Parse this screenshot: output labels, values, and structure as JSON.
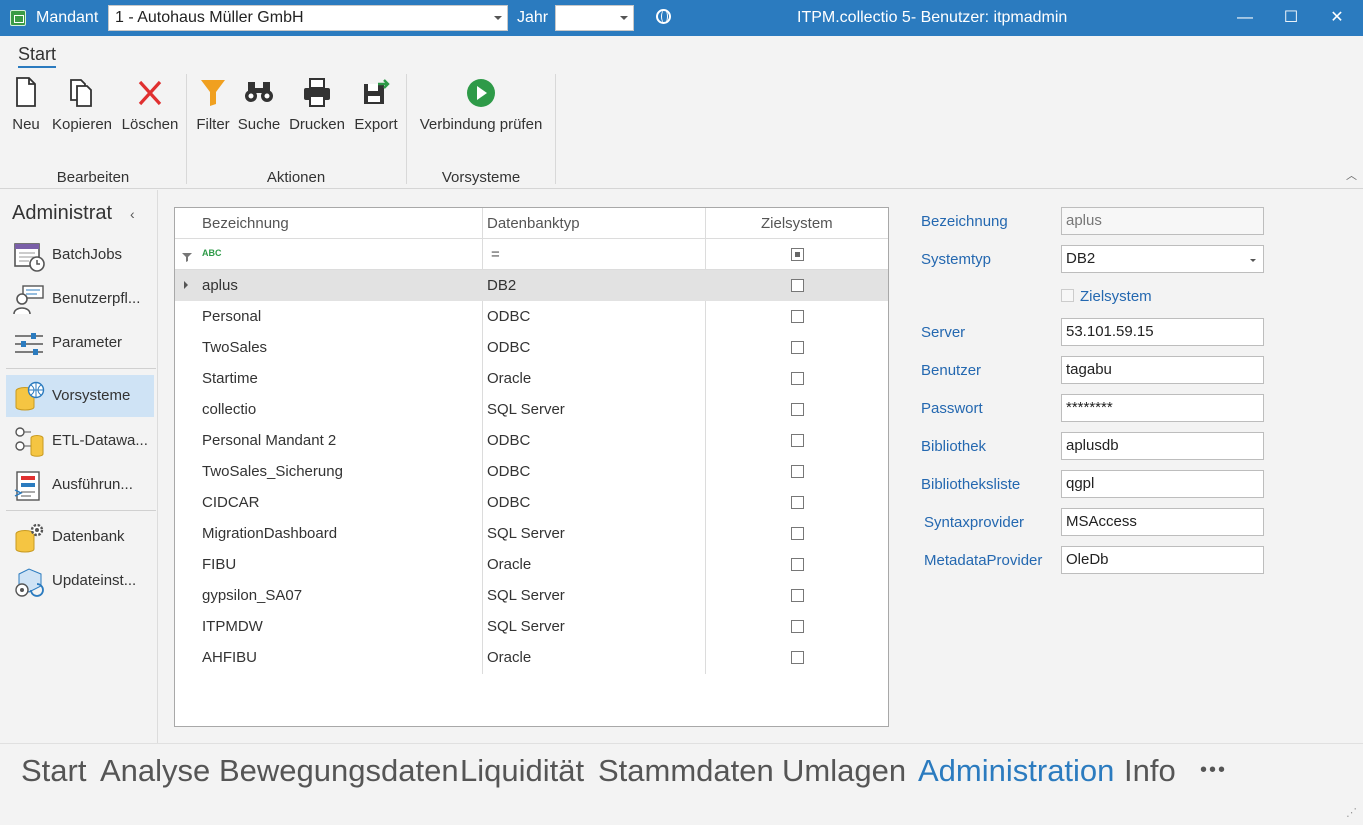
{
  "titlebar": {
    "mandant_label": "Mandant",
    "mandant_value": "1 - Autohaus Müller GmbH",
    "jahr_label": "Jahr",
    "jahr_value": "",
    "title": "ITPM.collectio 5- Benutzer: itpmadmin",
    "minimize": "—",
    "maximize": "☐",
    "close": "✕"
  },
  "ribbon": {
    "tab": "Start",
    "buttons": [
      {
        "label": "Neu",
        "icon": "new-document-icon"
      },
      {
        "label": "Kopieren",
        "icon": "copy-icon"
      },
      {
        "label": "Löschen",
        "icon": "delete-icon"
      },
      {
        "label": "Filter",
        "icon": "filter-icon"
      },
      {
        "label": "Suche",
        "icon": "binoculars-icon"
      },
      {
        "label": "Drucken",
        "icon": "printer-icon"
      },
      {
        "label": "Export",
        "icon": "export-icon"
      },
      {
        "label": "Verbindung prüfen",
        "icon": "play-icon"
      }
    ],
    "groups": [
      "Bearbeiten",
      "Aktionen",
      "Vorsysteme"
    ]
  },
  "sidebar": {
    "title": "Administrat",
    "items": [
      {
        "label": "BatchJobs",
        "icon": "calendar-clock-icon"
      },
      {
        "label": "Benutzerpfl...",
        "icon": "user-admin-icon"
      },
      {
        "label": "Parameter",
        "icon": "sliders-icon"
      },
      {
        "label": "Vorsysteme",
        "icon": "database-globe-icon",
        "active": true
      },
      {
        "label": "ETL-Datawa...",
        "icon": "etl-database-icon"
      },
      {
        "label": "Ausführun...",
        "icon": "execution-log-icon"
      },
      {
        "label": "Datenbank",
        "icon": "database-gear-icon"
      },
      {
        "label": "Updateinst...",
        "icon": "update-install-icon"
      }
    ]
  },
  "grid": {
    "columns": [
      "Bezeichnung",
      "Datenbanktyp",
      "Zielsystem"
    ],
    "filter_text_icon": "text-filter-icon",
    "filter_equals": "=",
    "rows": [
      {
        "name": "aplus",
        "type": "DB2",
        "ziel": false
      },
      {
        "name": "Personal",
        "type": "ODBC",
        "ziel": false
      },
      {
        "name": "TwoSales",
        "type": "ODBC",
        "ziel": false
      },
      {
        "name": "Startime",
        "type": "Oracle",
        "ziel": false
      },
      {
        "name": "collectio",
        "type": "SQL Server",
        "ziel": false
      },
      {
        "name": "Personal Mandant 2",
        "type": "ODBC",
        "ziel": false
      },
      {
        "name": "TwoSales_Sicherung",
        "type": "ODBC",
        "ziel": false
      },
      {
        "name": "CIDCAR",
        "type": "ODBC",
        "ziel": false
      },
      {
        "name": "MigrationDashboard",
        "type": "SQL Server",
        "ziel": false
      },
      {
        "name": "FIBU",
        "type": "Oracle",
        "ziel": false
      },
      {
        "name": "gypsilon_SA07",
        "type": "SQL Server",
        "ziel": false
      },
      {
        "name": "ITPMDW",
        "type": "SQL Server",
        "ziel": false
      },
      {
        "name": "AHFIBU",
        "type": "Oracle",
        "ziel": false
      }
    ]
  },
  "detail": {
    "bezeichnung_label": "Bezeichnung",
    "bezeichnung_value": "aplus",
    "systemtyp_label": "Systemtyp",
    "systemtyp_value": "DB2",
    "zielsystem_label": "Zielsystem",
    "server_label": "Server",
    "server_value": "53.101.59.15",
    "benutzer_label": "Benutzer",
    "benutzer_value": "tagabu",
    "passwort_label": "Passwort",
    "passwort_value": "********",
    "bibliothek_label": "Bibliothek",
    "bibliothek_value": "aplusdb",
    "bibliotheksliste_label": "Bibliotheksliste",
    "bibliotheksliste_value": "qgpl",
    "syntaxprovider_label": "Syntaxprovider",
    "syntaxprovider_value": "MSAccess",
    "metadataprovider_label": "MetadataProvider",
    "metadataprovider_value": "OleDb"
  },
  "bottomnav": {
    "items": [
      "Start",
      "Analyse",
      "Bewegungsdaten",
      "Liquidität",
      "Stammdaten",
      "Umlagen",
      "Administration",
      "Info"
    ],
    "active": "Administration",
    "more": "•••"
  },
  "colors": {
    "accent": "#2b7bbf",
    "label_blue": "#2468b0",
    "delete_red": "#e03030",
    "filter_orange": "#f0a020",
    "play_green": "#2e9a48"
  }
}
